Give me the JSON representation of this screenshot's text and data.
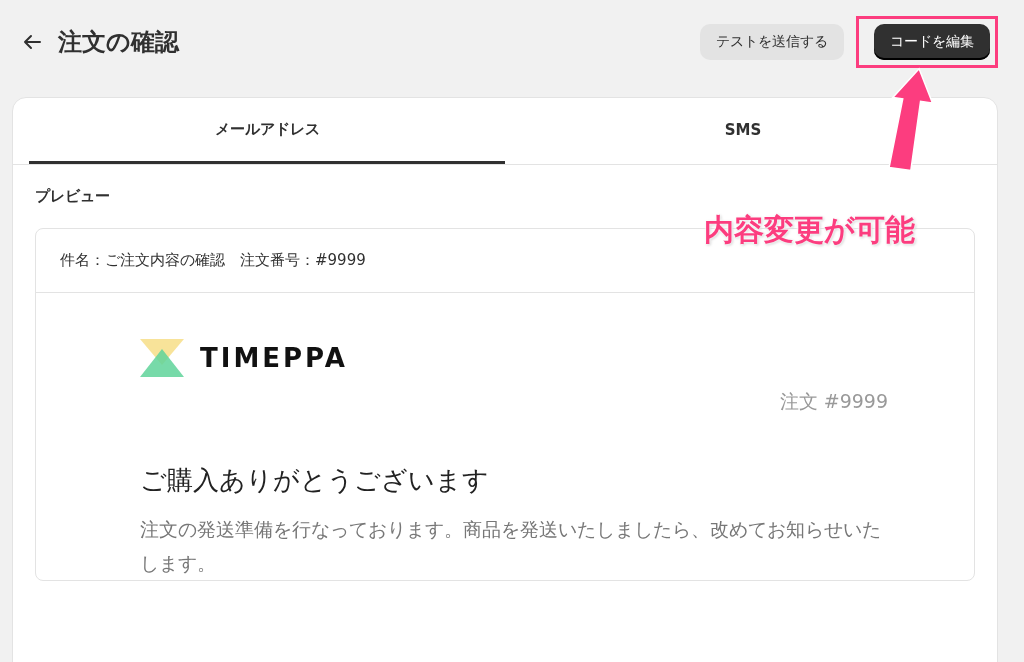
{
  "page": {
    "title": "注文の確認"
  },
  "buttons": [
    {
      "label": "テストを送信する",
      "kind": "secondary",
      "highlighted": false
    },
    {
      "label": "コードを編集",
      "kind": "primary",
      "highlighted": true
    }
  ],
  "annotation": {
    "text": "内容変更が可能"
  },
  "tabs": [
    {
      "label": "メールアドレス",
      "selected": true
    },
    {
      "label": "SMS",
      "selected": false
    }
  ],
  "preview": {
    "label": "プレビュー",
    "subject": "件名：ご注文内容の確認　注文番号：#9999",
    "email": {
      "logo_text": "TIMEPPA",
      "order_number": "注文 #9999",
      "heading": "ご購入ありがとうございます",
      "body": "注文の発送準備を行なっております。商品を発送いたしましたら、改めてお知らせいたします。"
    }
  }
}
